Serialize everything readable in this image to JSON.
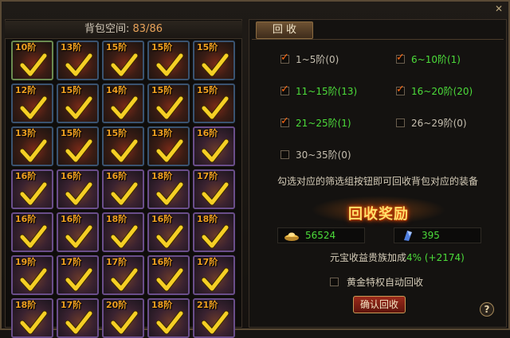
{
  "bag": {
    "title_prefix": "背包空间: ",
    "count": "83/86",
    "slots": [
      {
        "lvl": "10阶",
        "style": "sel"
      },
      {
        "lvl": "13阶",
        "style": ""
      },
      {
        "lvl": "15阶",
        "style": ""
      },
      {
        "lvl": "15阶",
        "style": ""
      },
      {
        "lvl": "15阶",
        "style": ""
      },
      {
        "lvl": "12阶",
        "style": ""
      },
      {
        "lvl": "15阶",
        "style": ""
      },
      {
        "lvl": "14阶",
        "style": ""
      },
      {
        "lvl": "15阶",
        "style": ""
      },
      {
        "lvl": "15阶",
        "style": ""
      },
      {
        "lvl": "13阶",
        "style": ""
      },
      {
        "lvl": "15阶",
        "style": ""
      },
      {
        "lvl": "15阶",
        "style": ""
      },
      {
        "lvl": "13阶",
        "style": ""
      },
      {
        "lvl": "16阶",
        "style": "purple"
      },
      {
        "lvl": "16阶",
        "style": "purple"
      },
      {
        "lvl": "16阶",
        "style": "purple"
      },
      {
        "lvl": "16阶",
        "style": "purple"
      },
      {
        "lvl": "18阶",
        "style": "purple"
      },
      {
        "lvl": "17阶",
        "style": "purple"
      },
      {
        "lvl": "16阶",
        "style": "purple"
      },
      {
        "lvl": "16阶",
        "style": "purple"
      },
      {
        "lvl": "18阶",
        "style": "purple"
      },
      {
        "lvl": "16阶",
        "style": "purple"
      },
      {
        "lvl": "18阶",
        "style": "purple"
      },
      {
        "lvl": "19阶",
        "style": "purple"
      },
      {
        "lvl": "17阶",
        "style": "purple"
      },
      {
        "lvl": "17阶",
        "style": "purple"
      },
      {
        "lvl": "16阶",
        "style": "purple"
      },
      {
        "lvl": "17阶",
        "style": "purple"
      },
      {
        "lvl": "18阶",
        "style": "purple"
      },
      {
        "lvl": "17阶",
        "style": "purple"
      },
      {
        "lvl": "20阶",
        "style": "purple"
      },
      {
        "lvl": "18阶",
        "style": "purple"
      },
      {
        "lvl": "21阶",
        "style": "purple"
      }
    ]
  },
  "recycle": {
    "tab_label": "回 收",
    "options": [
      {
        "label": "1~5阶(0)",
        "checked": true,
        "color": "plain"
      },
      {
        "label": "6~10阶(1)",
        "checked": true,
        "color": "green"
      },
      {
        "label": "11~15阶(13)",
        "checked": true,
        "color": "green"
      },
      {
        "label": "16~20阶(20)",
        "checked": true,
        "color": "green"
      },
      {
        "label": "21~25阶(1)",
        "checked": true,
        "color": "green"
      },
      {
        "label": "26~29阶(0)",
        "checked": false,
        "color": "plain"
      },
      {
        "label": "30~35阶(0)",
        "checked": false,
        "color": "plain"
      }
    ],
    "hint": "勾选对应的筛选组按钮即可回收背包对应的装备",
    "reward_title": "回收奖励",
    "gold_value": "56524",
    "crystal_value": "395",
    "bonus_text": "元宝收益贵族加成",
    "bonus_value": "4% (+2174)",
    "auto_label": "黄金特权自动回收",
    "confirm_label": "确认回收",
    "help_label": "?"
  },
  "icons": {
    "close": "close-icon",
    "check": "checkmark-icon",
    "gold": "gold-ingot-icon",
    "crystal": "crystal-icon",
    "help": "help-icon"
  },
  "colors": {
    "accent_orange": "#e8a35a",
    "green": "#4cdc3a",
    "check_orange": "#ff6a14"
  }
}
